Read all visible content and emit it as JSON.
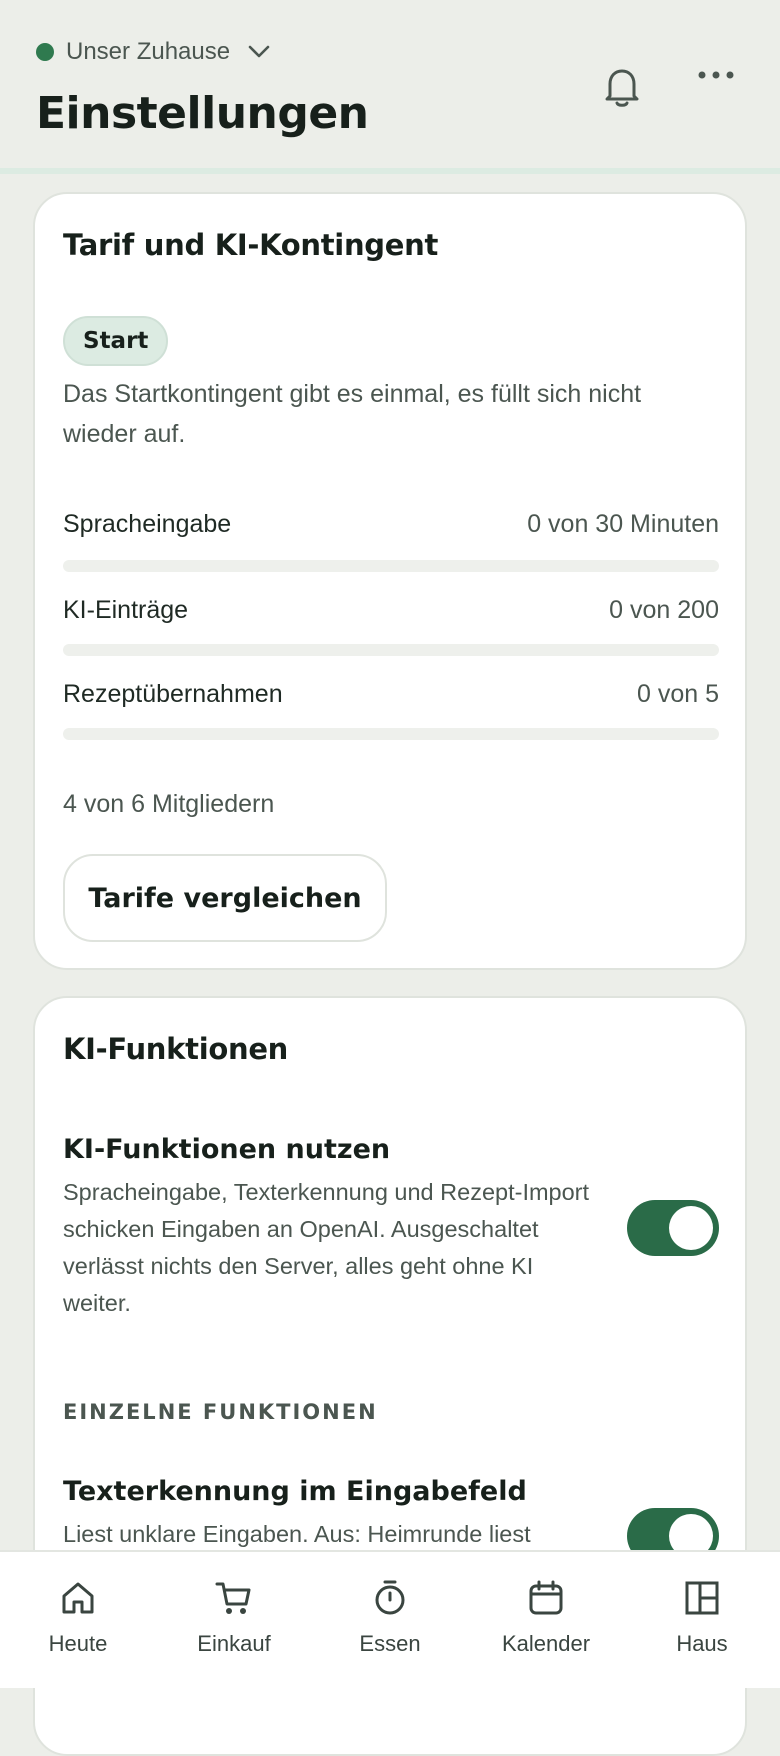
{
  "header": {
    "household_name": "Unser Zuhause",
    "household_status_color": "#2f7a4f",
    "title": "Einstellungen",
    "icons": [
      "bell-icon",
      "more-icon",
      "chevron-down-icon"
    ]
  },
  "plan_card": {
    "title": "Tarif und KI-Kontingent",
    "badge": "Start",
    "description": "Das Startkontingent gibt es einmal, es füllt sich nicht wieder auf.",
    "quotas": [
      {
        "label": "Spracheingabe",
        "value": "0 von 30 Minuten",
        "fraction": 0
      },
      {
        "label": "KI-Einträge",
        "value": "0 von 200",
        "fraction": 0
      },
      {
        "label": "Rezeptübernahmen",
        "value": "0 von 5",
        "fraction": 0
      }
    ],
    "members": "4 von 6 Mitgliedern",
    "compare_button": "Tarife vergleichen"
  },
  "ai_card": {
    "title": "KI-Funktionen",
    "main_setting": {
      "title": "KI-Funktionen nutzen",
      "description": "Spracheingabe, Texterkennung und Rezept-Import schicken Eingaben an OpenAI. Ausgeschaltet verlässt nichts den Server, alles geht ohne KI weiter.",
      "enabled": true
    },
    "section_label": "EINZELNE FUNKTIONEN",
    "text_recognition": {
      "title": "Texterkennung im Eingabefeld",
      "description": "Liest unklare Eingaben. Aus: Heimrunde liest",
      "enabled": true
    }
  },
  "nav": {
    "items": [
      {
        "label": "Heute",
        "icon": "home-icon"
      },
      {
        "label": "Einkauf",
        "icon": "cart-icon"
      },
      {
        "label": "Essen",
        "icon": "timer-icon"
      },
      {
        "label": "Kalender",
        "icon": "calendar-icon"
      },
      {
        "label": "Haus",
        "icon": "layout-icon"
      }
    ]
  },
  "colors": {
    "accent": "#2a6b48",
    "background": "#eceee9",
    "badge_bg": "#dcebe2"
  }
}
